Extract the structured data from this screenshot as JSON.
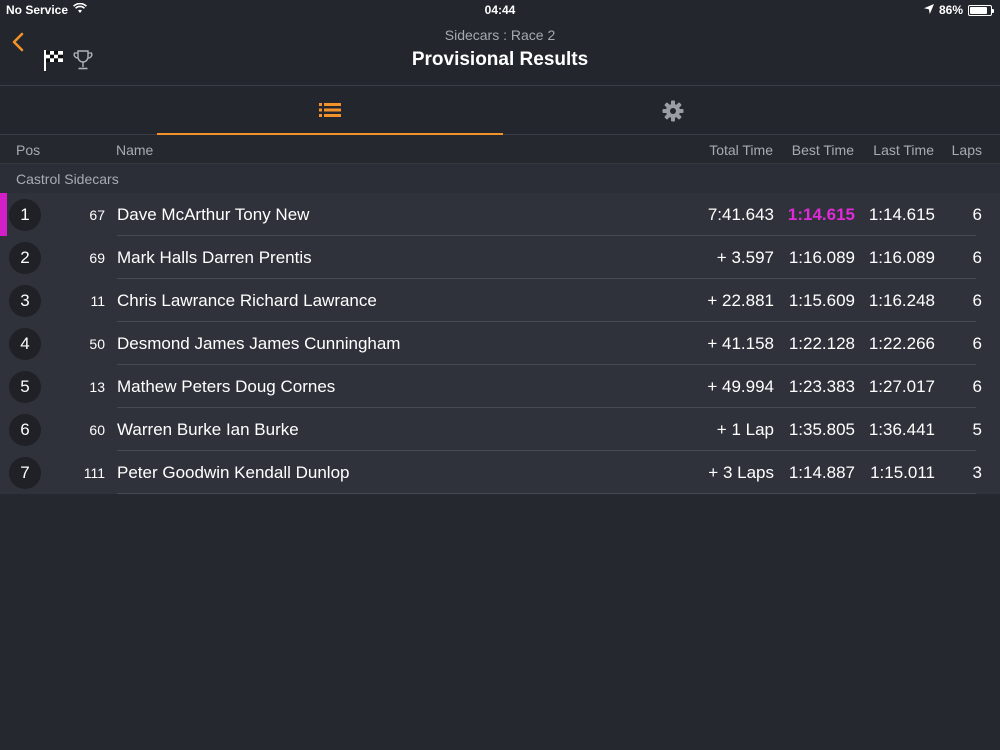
{
  "status": {
    "carrier": "No Service",
    "time": "04:44",
    "battery": "86%",
    "battery_level": 0.86
  },
  "header": {
    "subtitle": "Sidecars : Race 2",
    "title": "Provisional Results"
  },
  "tabs": [
    {
      "icon": "list-icon",
      "active": true
    },
    {
      "icon": "gear-icon",
      "active": false
    }
  ],
  "columns": {
    "pos": "Pos",
    "name": "Name",
    "total": "Total Time",
    "best": "Best Time",
    "last": "Last Time",
    "laps": "Laps"
  },
  "group": "Castrol Sidecars",
  "colors": {
    "accent": "#f2922a",
    "fastest": "#e02ad8"
  },
  "results": [
    {
      "pos": "1",
      "num": "67",
      "name": "Dave McArthur Tony New",
      "total": "7:41.643",
      "best": "1:14.615",
      "last": "1:14.615",
      "laps": "6",
      "fastest": true
    },
    {
      "pos": "2",
      "num": "69",
      "name": "Mark Halls Darren Prentis",
      "total": "+ 3.597",
      "best": "1:16.089",
      "last": "1:16.089",
      "laps": "6"
    },
    {
      "pos": "3",
      "num": "11",
      "name": "Chris Lawrance Richard Lawrance",
      "total": "+ 22.881",
      "best": "1:15.609",
      "last": "1:16.248",
      "laps": "6"
    },
    {
      "pos": "4",
      "num": "50",
      "name": "Desmond James James Cunningham",
      "total": "+ 41.158",
      "best": "1:22.128",
      "last": "1:22.266",
      "laps": "6"
    },
    {
      "pos": "5",
      "num": "13",
      "name": "Mathew Peters Doug Cornes",
      "total": "+ 49.994",
      "best": "1:23.383",
      "last": "1:27.017",
      "laps": "6"
    },
    {
      "pos": "6",
      "num": "60",
      "name": "Warren Burke Ian Burke",
      "total": "+ 1 Lap",
      "best": "1:35.805",
      "last": "1:36.441",
      "laps": "5"
    },
    {
      "pos": "7",
      "num": "111",
      "name": "Peter Goodwin Kendall Dunlop",
      "total": "+ 3 Laps",
      "best": "1:14.887",
      "last": "1:15.011",
      "laps": "3"
    }
  ]
}
